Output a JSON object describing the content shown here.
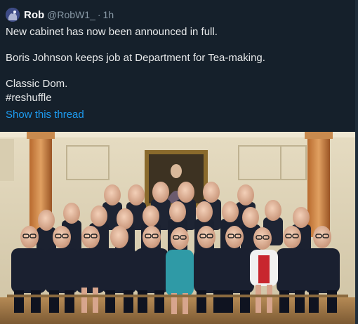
{
  "tweet": {
    "author": {
      "display_name": "Rob",
      "handle": "@RobW1_",
      "separator": "·",
      "time": "1h",
      "avatar_icon": "avatar-image"
    },
    "lines": [
      "New cabinet has now been announced in full.",
      "Boris Johnson keeps job at Department for Tea-making.",
      "Classic Dom.",
      "#reshuffle"
    ],
    "show_thread_label": "Show this thread",
    "link_color": "#1d9bf0",
    "media": {
      "type": "photo",
      "rows": [
        {
          "count": 7
        },
        {
          "count": 11
        },
        {
          "count": 11
        }
      ]
    }
  },
  "colors": {
    "background": "#15202b",
    "text": "#e7e9ea",
    "muted": "#8899a6"
  }
}
